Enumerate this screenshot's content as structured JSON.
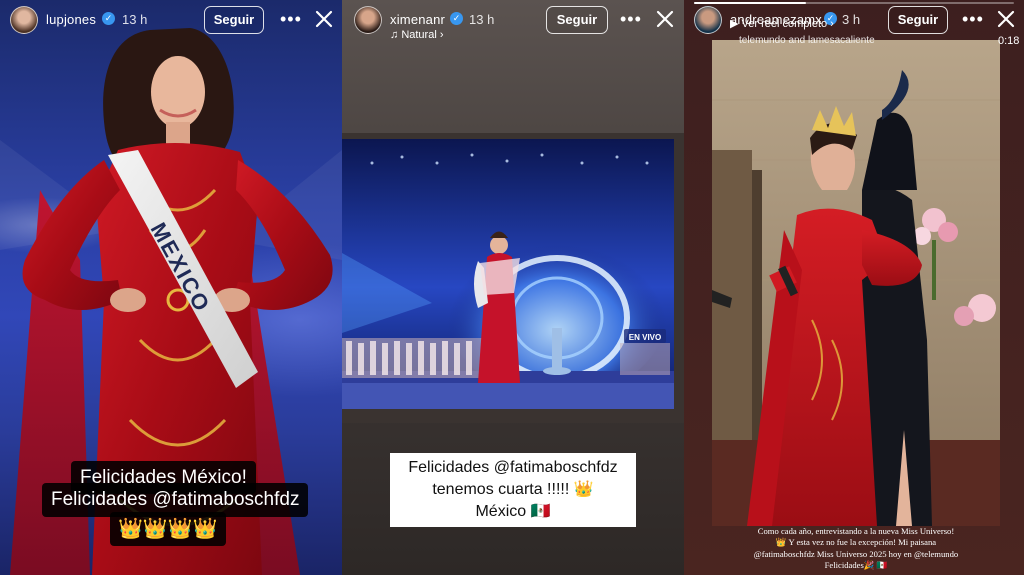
{
  "stories": [
    {
      "username": "lupjones",
      "time": "13 h",
      "follow_label": "Seguir",
      "caption": [
        "Felicidades México!",
        "Felicidades @fatimaboschfdz",
        "👑👑👑👑"
      ],
      "sash_text": "MEXICO"
    },
    {
      "username": "ximenanr",
      "time": "13 h",
      "subtitle": "Natural",
      "follow_label": "Seguir",
      "caption": [
        "Felicidades @fatimaboschfdz",
        "tenemos cuarta !!!!! 👑",
        "México 🇲🇽"
      ],
      "tv_badge": "EN VIVO"
    },
    {
      "username": "andreamezamx",
      "time": "3 h",
      "subtitle": "Ver reel completo",
      "follow_label": "Seguir",
      "mention": "telemundo and lamesacaliente",
      "video_time": "0:18",
      "progress": 0.35,
      "caption": [
        "Como cada año, entrevistando a la nueva Miss Universo!",
        "👑 Y esta vez no fue la excepción! Mi paisana",
        "@fatimaboschfdz Miss Universo 2025 hoy en @telemundo",
        "Felicidades🎉 🇲🇽"
      ]
    }
  ],
  "icons": {
    "verified": "verified-badge-icon",
    "more": "more-options-icon",
    "close": "close-icon",
    "music": "music-note-icon"
  },
  "colors": {
    "verified": "#3897f0",
    "dress_red": "#b0101a",
    "crown_gold": "#f3c51c"
  }
}
